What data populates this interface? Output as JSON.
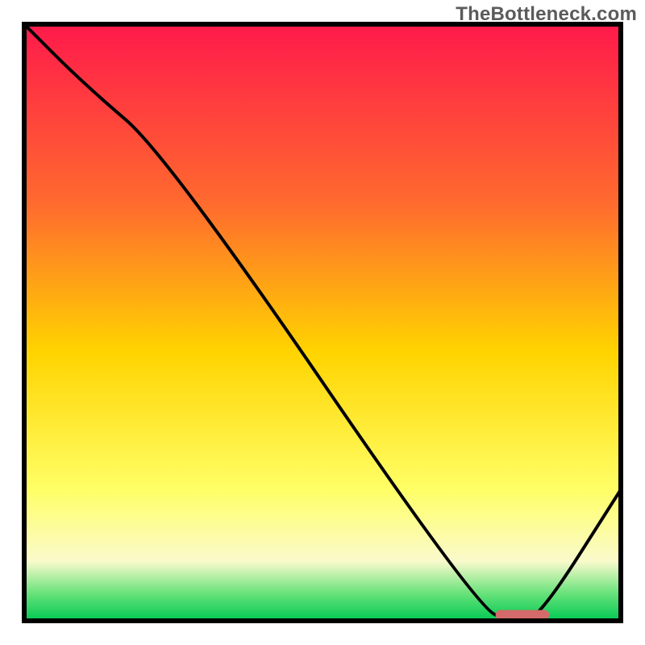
{
  "watermark": "TheBottleneck.com",
  "chart_data": {
    "type": "line",
    "title": "",
    "xlabel": "",
    "ylabel": "",
    "xlim": [
      0,
      100
    ],
    "ylim": [
      0,
      100
    ],
    "grid": false,
    "legend": false,
    "background_gradient": {
      "stops": [
        {
          "offset": 0.0,
          "color": "#ff1a4b"
        },
        {
          "offset": 0.3,
          "color": "#ff6a2e"
        },
        {
          "offset": 0.55,
          "color": "#ffd400"
        },
        {
          "offset": 0.78,
          "color": "#ffff66"
        },
        {
          "offset": 0.9,
          "color": "#fafacc"
        },
        {
          "offset": 0.955,
          "color": "#66e27a"
        },
        {
          "offset": 1.0,
          "color": "#00c853"
        }
      ]
    },
    "series": [
      {
        "name": "bottleneck-curve",
        "x": [
          0,
          10,
          24,
          76,
          82,
          86,
          100
        ],
        "y": [
          100,
          90,
          78,
          2,
          0,
          0,
          22
        ]
      }
    ],
    "optimal_marker": {
      "x_start": 79,
      "x_end": 88,
      "y": 1,
      "color": "#d46a6a"
    },
    "plot_border_color": "#000000",
    "plot_border_width": 6
  }
}
